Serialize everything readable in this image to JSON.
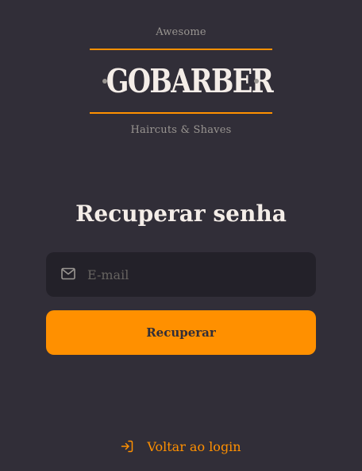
{
  "logo": {
    "tagline_top": "Awesome",
    "brand": "GOBARBER",
    "tagline_bottom": "Haircuts & Shaves"
  },
  "form": {
    "title": "Recuperar senha",
    "email_placeholder": "E-mail",
    "email_value": "",
    "submit_label": "Recuperar"
  },
  "footer": {
    "back_label": "Voltar ao login"
  },
  "icons": {
    "email": "mail-icon",
    "back": "log-in-icon"
  },
  "colors": {
    "background": "#312e38",
    "accent": "#ff9000",
    "input_background": "#232129",
    "text": "#f4ede8",
    "muted": "#999591",
    "placeholder": "#666360"
  }
}
